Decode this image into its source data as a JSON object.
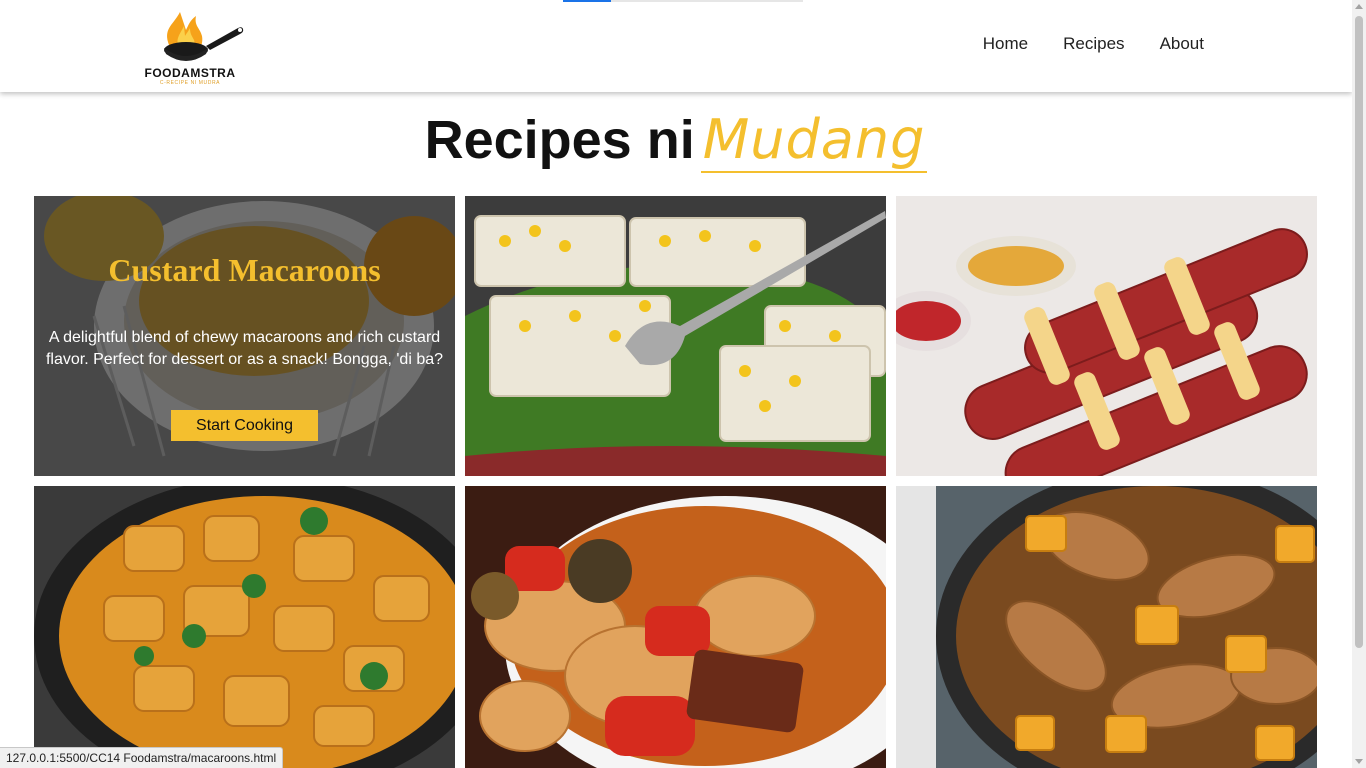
{
  "brand": {
    "name": "FOODAMSTRA",
    "tagline": "C-RECIPE NI MUDRA"
  },
  "nav": {
    "items": [
      "Home",
      "Recipes",
      "About"
    ]
  },
  "page": {
    "title": "Recipes ni",
    "title_accent": "Mudang"
  },
  "featured": {
    "title": "Custard Macaroons",
    "description": "A delightful blend of chewy macaroons and rich custard flavor. Perfect for dessert or as a snack! Bongga, 'di ba?",
    "button_label": "Start Cooking"
  },
  "status_url": "127.0.0.1:5500/CC14 Foodamstra/macaroons.html",
  "colors": {
    "accent": "#f4bf2e",
    "header_bg": "#ffffff",
    "text": "#111111"
  }
}
